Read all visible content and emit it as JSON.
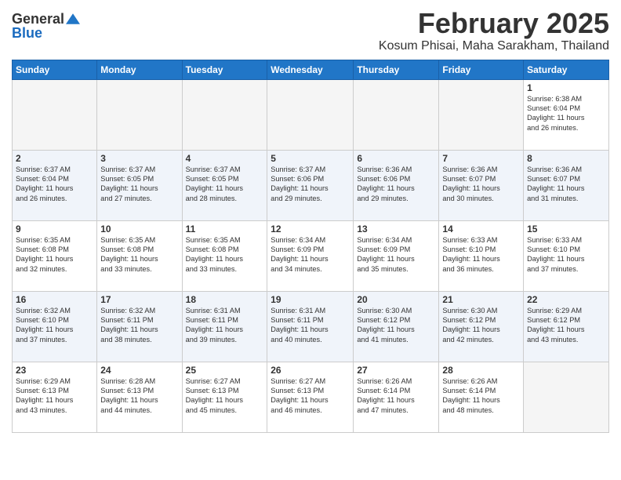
{
  "header": {
    "logo_general": "General",
    "logo_blue": "Blue",
    "month_title": "February 2025",
    "location": "Kosum Phisai, Maha Sarakham, Thailand"
  },
  "days_of_week": [
    "Sunday",
    "Monday",
    "Tuesday",
    "Wednesday",
    "Thursday",
    "Friday",
    "Saturday"
  ],
  "weeks": [
    [
      {
        "day": "",
        "info": ""
      },
      {
        "day": "",
        "info": ""
      },
      {
        "day": "",
        "info": ""
      },
      {
        "day": "",
        "info": ""
      },
      {
        "day": "",
        "info": ""
      },
      {
        "day": "",
        "info": ""
      },
      {
        "day": "1",
        "info": "Sunrise: 6:38 AM\nSunset: 6:04 PM\nDaylight: 11 hours\nand 26 minutes."
      }
    ],
    [
      {
        "day": "2",
        "info": "Sunrise: 6:37 AM\nSunset: 6:04 PM\nDaylight: 11 hours\nand 26 minutes."
      },
      {
        "day": "3",
        "info": "Sunrise: 6:37 AM\nSunset: 6:05 PM\nDaylight: 11 hours\nand 27 minutes."
      },
      {
        "day": "4",
        "info": "Sunrise: 6:37 AM\nSunset: 6:05 PM\nDaylight: 11 hours\nand 28 minutes."
      },
      {
        "day": "5",
        "info": "Sunrise: 6:37 AM\nSunset: 6:06 PM\nDaylight: 11 hours\nand 29 minutes."
      },
      {
        "day": "6",
        "info": "Sunrise: 6:36 AM\nSunset: 6:06 PM\nDaylight: 11 hours\nand 29 minutes."
      },
      {
        "day": "7",
        "info": "Sunrise: 6:36 AM\nSunset: 6:07 PM\nDaylight: 11 hours\nand 30 minutes."
      },
      {
        "day": "8",
        "info": "Sunrise: 6:36 AM\nSunset: 6:07 PM\nDaylight: 11 hours\nand 31 minutes."
      }
    ],
    [
      {
        "day": "9",
        "info": "Sunrise: 6:35 AM\nSunset: 6:08 PM\nDaylight: 11 hours\nand 32 minutes."
      },
      {
        "day": "10",
        "info": "Sunrise: 6:35 AM\nSunset: 6:08 PM\nDaylight: 11 hours\nand 33 minutes."
      },
      {
        "day": "11",
        "info": "Sunrise: 6:35 AM\nSunset: 6:08 PM\nDaylight: 11 hours\nand 33 minutes."
      },
      {
        "day": "12",
        "info": "Sunrise: 6:34 AM\nSunset: 6:09 PM\nDaylight: 11 hours\nand 34 minutes."
      },
      {
        "day": "13",
        "info": "Sunrise: 6:34 AM\nSunset: 6:09 PM\nDaylight: 11 hours\nand 35 minutes."
      },
      {
        "day": "14",
        "info": "Sunrise: 6:33 AM\nSunset: 6:10 PM\nDaylight: 11 hours\nand 36 minutes."
      },
      {
        "day": "15",
        "info": "Sunrise: 6:33 AM\nSunset: 6:10 PM\nDaylight: 11 hours\nand 37 minutes."
      }
    ],
    [
      {
        "day": "16",
        "info": "Sunrise: 6:32 AM\nSunset: 6:10 PM\nDaylight: 11 hours\nand 37 minutes."
      },
      {
        "day": "17",
        "info": "Sunrise: 6:32 AM\nSunset: 6:11 PM\nDaylight: 11 hours\nand 38 minutes."
      },
      {
        "day": "18",
        "info": "Sunrise: 6:31 AM\nSunset: 6:11 PM\nDaylight: 11 hours\nand 39 minutes."
      },
      {
        "day": "19",
        "info": "Sunrise: 6:31 AM\nSunset: 6:11 PM\nDaylight: 11 hours\nand 40 minutes."
      },
      {
        "day": "20",
        "info": "Sunrise: 6:30 AM\nSunset: 6:12 PM\nDaylight: 11 hours\nand 41 minutes."
      },
      {
        "day": "21",
        "info": "Sunrise: 6:30 AM\nSunset: 6:12 PM\nDaylight: 11 hours\nand 42 minutes."
      },
      {
        "day": "22",
        "info": "Sunrise: 6:29 AM\nSunset: 6:12 PM\nDaylight: 11 hours\nand 43 minutes."
      }
    ],
    [
      {
        "day": "23",
        "info": "Sunrise: 6:29 AM\nSunset: 6:13 PM\nDaylight: 11 hours\nand 43 minutes."
      },
      {
        "day": "24",
        "info": "Sunrise: 6:28 AM\nSunset: 6:13 PM\nDaylight: 11 hours\nand 44 minutes."
      },
      {
        "day": "25",
        "info": "Sunrise: 6:27 AM\nSunset: 6:13 PM\nDaylight: 11 hours\nand 45 minutes."
      },
      {
        "day": "26",
        "info": "Sunrise: 6:27 AM\nSunset: 6:13 PM\nDaylight: 11 hours\nand 46 minutes."
      },
      {
        "day": "27",
        "info": "Sunrise: 6:26 AM\nSunset: 6:14 PM\nDaylight: 11 hours\nand 47 minutes."
      },
      {
        "day": "28",
        "info": "Sunrise: 6:26 AM\nSunset: 6:14 PM\nDaylight: 11 hours\nand 48 minutes."
      },
      {
        "day": "",
        "info": ""
      }
    ]
  ]
}
